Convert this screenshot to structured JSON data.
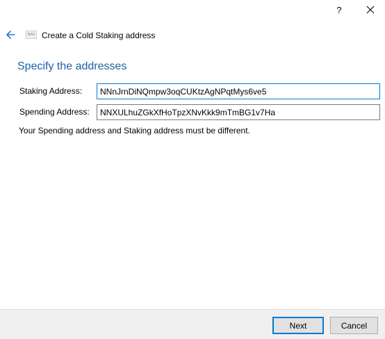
{
  "titlebar": {
    "help_label": "?",
    "close_icon": "close-icon"
  },
  "header": {
    "back_icon": "back-arrow-icon",
    "logo_text": "NAV",
    "title": "Create a Cold Staking address"
  },
  "page": {
    "heading": "Specify the addresses"
  },
  "form": {
    "staking_label": "Staking Address:",
    "staking_value": "NNnJrnDiNQmpw3oqCUKtzAgNPqtMys6ve5",
    "spending_label": "Spending Address:",
    "spending_value": "NNXULhuZGkXfHoTpzXNvKkk9mTmBG1v7Ha",
    "error_message": "Your Spending address and Staking address must be different."
  },
  "footer": {
    "next_label": "Next",
    "cancel_label": "Cancel"
  },
  "colors": {
    "heading": "#1f5fa8",
    "accent": "#0078d7",
    "footer_bg": "#f0f0f0"
  }
}
